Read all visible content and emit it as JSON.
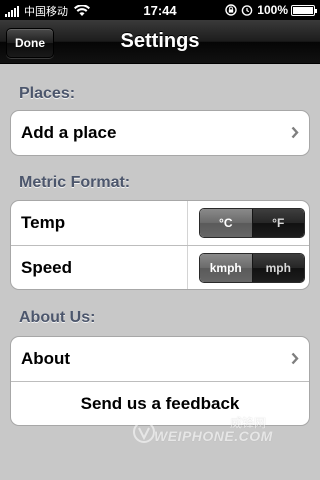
{
  "status_bar": {
    "carrier": "中国移动",
    "time": "17:44",
    "battery_text": "100%",
    "battery_level": 1.0
  },
  "nav": {
    "done_label": "Done",
    "title": "Settings"
  },
  "sections": {
    "places": {
      "header": "Places:",
      "add_place_label": "Add a place"
    },
    "metric": {
      "header": "Metric Format:",
      "temp_label": "Temp",
      "temp_options": [
        "°C",
        "°F"
      ],
      "temp_selected": "°C",
      "speed_label": "Speed",
      "speed_options": [
        "kmph",
        "mph"
      ],
      "speed_selected": "kmph"
    },
    "about": {
      "header": "About Us:",
      "about_label": "About",
      "feedback_label": "Send us a feedback"
    }
  },
  "watermark": {
    "text": "WEIPHONE.COM",
    "cn": "威锋网"
  },
  "icons": {
    "chevron": "chevron-right-icon",
    "wifi": "wifi-icon",
    "lock": "rotation-lock-icon",
    "alarm": "alarm-icon",
    "battery": "battery-icon"
  },
  "colors": {
    "background": "#c8c8c8",
    "section_header": "#4c566c",
    "nav_bar": "#1c1c1c",
    "segment_selected": "#6a6a6a",
    "segment_unselected": "#1d1d1d"
  }
}
